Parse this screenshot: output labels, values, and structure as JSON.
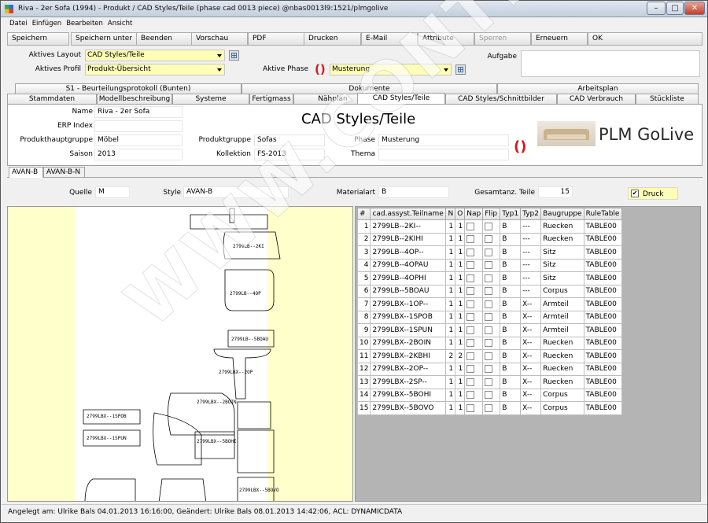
{
  "window": {
    "title": "Riva - 2er Sofa (1994) - Produkt / CAD Styles/Teile (phase cad 0013 piece) @nbas0013l9:1521/plmgolive",
    "controls": [
      "minimize",
      "maximize",
      "close"
    ]
  },
  "menu": [
    "Datei",
    "Einfügen",
    "Bearbeiten",
    "Ansicht"
  ],
  "toolbar": {
    "buttons": [
      "Speichern",
      "Speichern unter",
      "Beenden",
      "Vorschau",
      "PDF",
      "Drucken",
      "E-Mail",
      "Attribute",
      "Sperren",
      "Erneuern",
      "OK"
    ],
    "disabled": [
      "Sperren"
    ]
  },
  "layout_bar": {
    "aktives_layout_label": "Aktives Layout",
    "aktives_layout_value": "CAD Styles/Teile",
    "aktives_profil_label": "Aktives Profil",
    "aktives_profil_value": "Produkt-Übersicht",
    "aktive_phase_label": "Aktive Phase",
    "aktive_phase_value": "Musterung",
    "aufgabe_label": "Aufgabe",
    "aufgabe_value": ""
  },
  "tabs_row1": [
    "S1 - Beurteilungsprotokoll (Bunten)",
    "Dokumente",
    "Arbeitsplan"
  ],
  "tabs_row2": [
    "Stammdaten",
    "Modellbeschreibung",
    "Systeme",
    "Fertigmass",
    "Nähplan",
    "CAD Styles/Teile",
    "CAD Styles/Schnittbilder",
    "CAD Verbrauch",
    "Stückliste"
  ],
  "active_tab": "CAD Styles/Teile",
  "header": {
    "name_label": "Name",
    "name_value": "Riva - 2er Sofa",
    "erp_label": "ERP Index",
    "erp_value": "",
    "produkthauptgruppe_label": "Produkthauptgruppe",
    "produkthauptgruppe_value": "Möbel",
    "saison_label": "Saison",
    "saison_value": "2013",
    "produktgruppe_label": "Produktgruppe",
    "produktgruppe_value": "Sofas",
    "kollektion_label": "Kollektion",
    "kollektion_value": "FS-2013",
    "phase_label": "Phase",
    "phase_value": "Musterung",
    "thema_label": "Thema",
    "thema_value": "",
    "page_title": "CAD Styles/Teile",
    "logo_text": "PLM GoLive"
  },
  "subtabs": [
    "AVAN-B",
    "AVAN-B-N"
  ],
  "active_subtab": "AVAN-B",
  "style_bar": {
    "quelle_label": "Quelle",
    "quelle_value": "M",
    "style_label": "Style",
    "style_value": "AVAN-B",
    "materialart_label": "Materialart",
    "materialart_value": "B",
    "gesamtanz_label": "Gesamtanz. Teile",
    "gesamtanz_value": "15",
    "druck_label": "Druck",
    "druck_checked": true
  },
  "parts_table": {
    "columns": [
      "#",
      "cad.assyst.Teilname",
      "N",
      "O",
      "Nap",
      "Flip",
      "Typ1",
      "Typ2",
      "Baugruppe",
      "RuleTable"
    ],
    "rows": [
      [
        "1",
        "2799LB--2KI--",
        "1",
        "1",
        "",
        "",
        "B",
        "---",
        "Ruecken",
        "TABLE00"
      ],
      [
        "2",
        "2799LB--2KIHI",
        "1",
        "1",
        "",
        "",
        "B",
        "---",
        "Ruecken",
        "TABLE00"
      ],
      [
        "3",
        "2799LB--4OP--",
        "1",
        "1",
        "",
        "",
        "B",
        "---",
        "Sitz",
        "TABLE00"
      ],
      [
        "4",
        "2799LB--4OPAU",
        "1",
        "1",
        "",
        "",
        "B",
        "---",
        "Sitz",
        "TABLE00"
      ],
      [
        "5",
        "2799LB--4OPHI",
        "1",
        "1",
        "",
        "",
        "B",
        "---",
        "Sitz",
        "TABLE00"
      ],
      [
        "6",
        "2799LB--5BOAU",
        "1",
        "1",
        "",
        "",
        "B",
        "---",
        "Corpus",
        "TABLE00"
      ],
      [
        "7",
        "2799LBX--1OP--",
        "1",
        "1",
        "",
        "",
        "B",
        "X--",
        "Armteil",
        "TABLE00"
      ],
      [
        "8",
        "2799LBX--1SPOB",
        "1",
        "1",
        "",
        "",
        "B",
        "X--",
        "Armteil",
        "TABLE00"
      ],
      [
        "9",
        "2799LBX--1SPUN",
        "1",
        "1",
        "",
        "",
        "B",
        "X--",
        "Armteil",
        "TABLE00"
      ],
      [
        "10",
        "2799LBX--2BOIN",
        "1",
        "1",
        "",
        "",
        "B",
        "X--",
        "Ruecken",
        "TABLE00"
      ],
      [
        "11",
        "2799LBX--2KBHI",
        "2",
        "2",
        "",
        "",
        "B",
        "X--",
        "Ruecken",
        "TABLE00"
      ],
      [
        "12",
        "2799LBX--2OP--",
        "1",
        "1",
        "",
        "",
        "B",
        "X--",
        "Ruecken",
        "TABLE00"
      ],
      [
        "13",
        "2799LBX--2SP--",
        "1",
        "1",
        "",
        "",
        "B",
        "X--",
        "Ruecken",
        "TABLE00"
      ],
      [
        "14",
        "2799LBX--5BOHI",
        "1",
        "1",
        "",
        "",
        "B",
        "X--",
        "Corpus",
        "TABLE00"
      ],
      [
        "15",
        "2799LBX--5BOVO",
        "1",
        "1",
        "",
        "",
        "B",
        "X--",
        "Corpus",
        "TABLE00"
      ]
    ]
  },
  "pattern_labels": [
    "2799LB--2KI",
    "2799LB--4OP",
    "2799LB--5BOAU",
    "2799LBX--2OP",
    "2799LBX--1SPOB",
    "2799LBX--1SPUN",
    "2799LBX--2BOIN",
    "2799LBX--5BOHI",
    "2799LBX--5BOVO"
  ],
  "statusbar": "Angelegt am: Ulrike Bals 04.01.2013 16:16:00, Geändert: Ulrike Bals 08.01.2013 14:42:06, ACL: DYNAMICDATA",
  "watermark": "WWW.CONTEC.PL",
  "colors": {
    "field_yellow": "#fdfdb6",
    "refresh_red": "#d21a1a",
    "canvas_yellow": "#ffffcc"
  }
}
